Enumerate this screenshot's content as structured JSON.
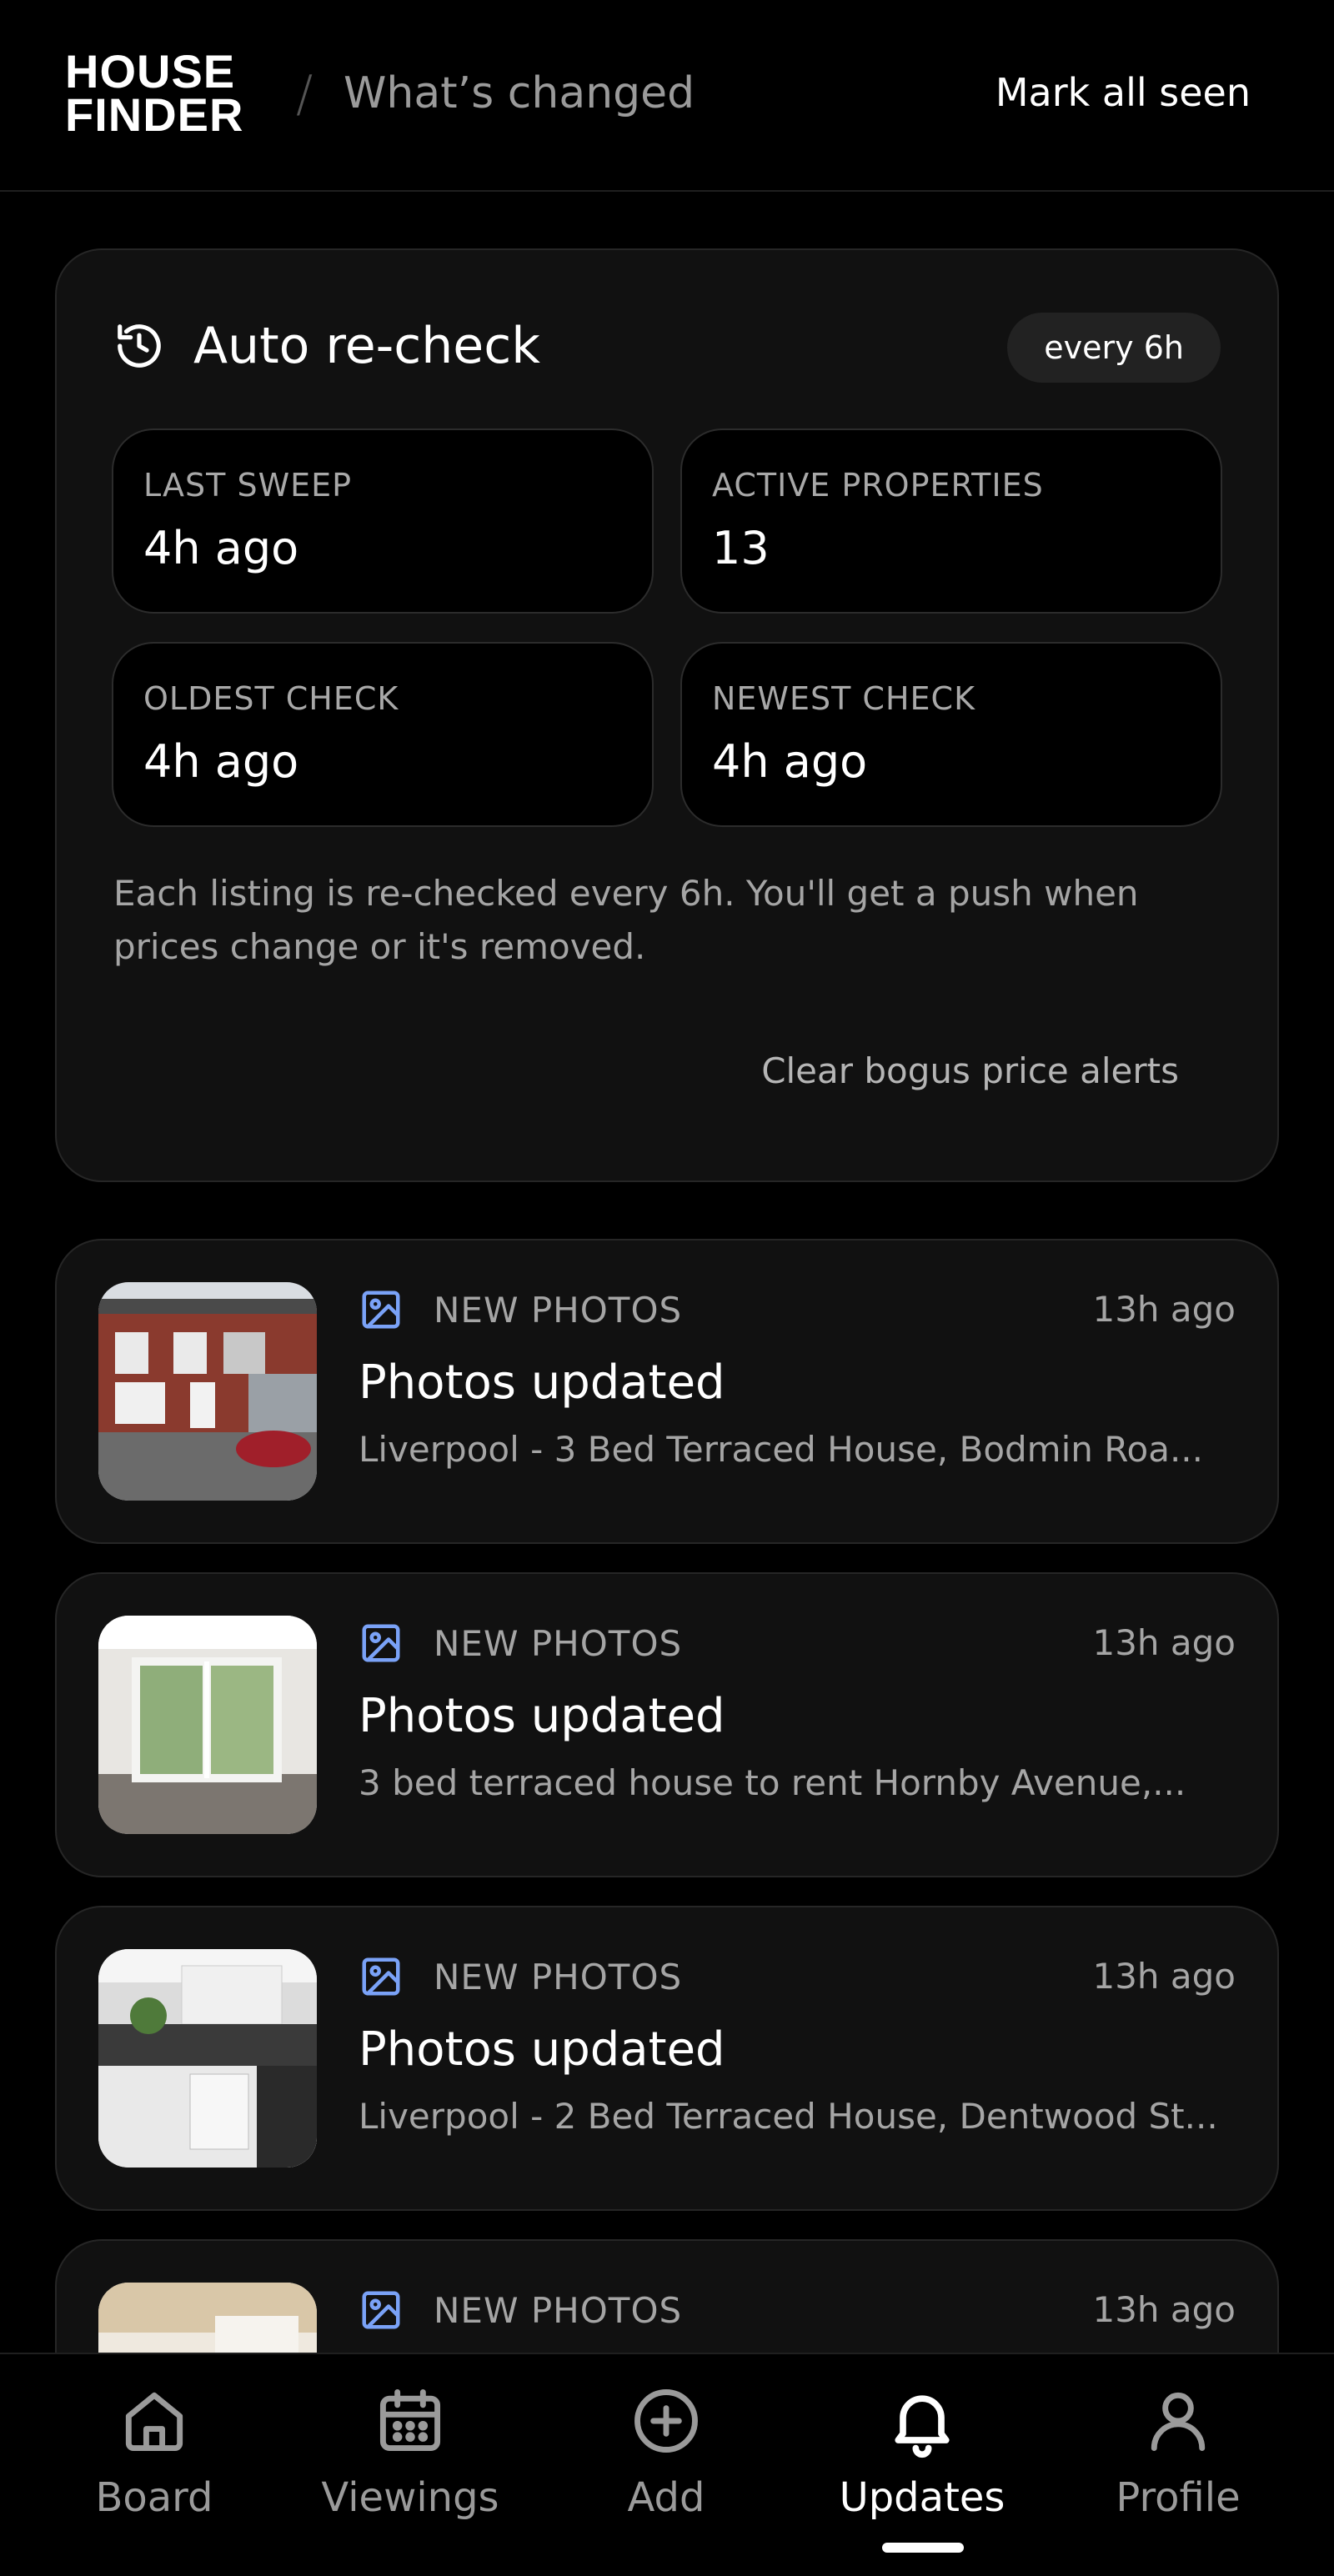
{
  "header": {
    "logo_line1": "HOUSE",
    "logo_line2": "FINDER",
    "separator": "/",
    "title": "What’s changed",
    "mark_all_label": "Mark all seen"
  },
  "recheck": {
    "icon": "history-icon",
    "title": "Auto re-check",
    "frequency": "every 6h",
    "stats": [
      {
        "label": "LAST SWEEP",
        "value": "4h ago"
      },
      {
        "label": "ACTIVE PROPERTIES",
        "value": "13"
      },
      {
        "label": "OLDEST CHECK",
        "value": "4h ago"
      },
      {
        "label": "NEWEST CHECK",
        "value": "4h ago"
      }
    ],
    "description": "Each listing is re-checked every 6h. You'll get a push when prices change or it's removed.",
    "clear_label": "Clear bogus price alerts"
  },
  "updates": [
    {
      "type_icon": "image-icon",
      "type": "NEW PHOTOS",
      "time": "13h ago",
      "title": "Photos updated",
      "subtitle": "Liverpool - 3 Bed Terraced House, Bodmin Roa..."
    },
    {
      "type_icon": "image-icon",
      "type": "NEW PHOTOS",
      "time": "13h ago",
      "title": "Photos updated",
      "subtitle": "3 bed terraced house to rent Hornby Avenue,..."
    },
    {
      "type_icon": "image-icon",
      "type": "NEW PHOTOS",
      "time": "13h ago",
      "title": "Photos updated",
      "subtitle": "Liverpool - 2 Bed Terraced House, Dentwood St..."
    },
    {
      "type_icon": "image-icon",
      "type": "NEW PHOTOS",
      "time": "13h ago",
      "title": "",
      "subtitle": ""
    }
  ],
  "nav": [
    {
      "icon": "home-icon",
      "label": "Board"
    },
    {
      "icon": "calendar-icon",
      "label": "Viewings"
    },
    {
      "icon": "plus-circle-icon",
      "label": "Add"
    },
    {
      "icon": "bell-icon",
      "label": "Updates",
      "active": true
    },
    {
      "icon": "user-icon",
      "label": "Profile"
    }
  ],
  "colors": {
    "accent_icon": "#7aa2f7",
    "card_bg": "#111111",
    "background": "#000000"
  }
}
